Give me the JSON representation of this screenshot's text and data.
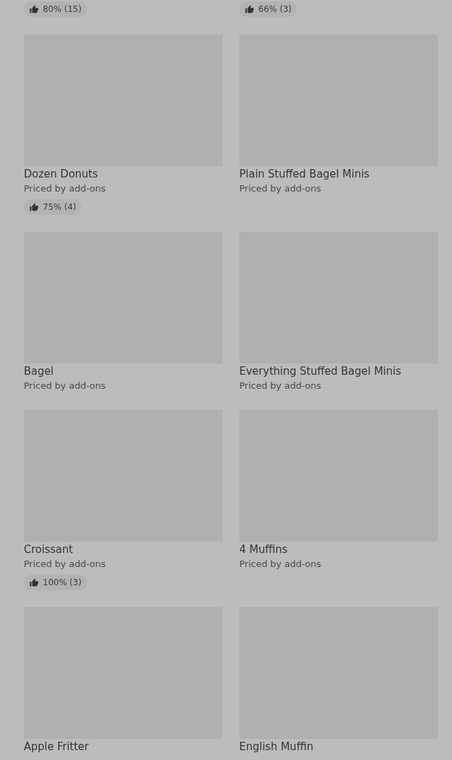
{
  "top_ratings": [
    {
      "rating": "80% (15)"
    },
    {
      "rating": "66% (3)"
    }
  ],
  "items": [
    {
      "name": "Dozen Donuts",
      "price": "Priced by add-ons",
      "rating": "75% (4)"
    },
    {
      "name": "Plain Stuffed Bagel Minis",
      "price": "Priced by add-ons"
    },
    {
      "name": "Bagel",
      "price": "Priced by add-ons"
    },
    {
      "name": "Everything Stuffed Bagel Minis",
      "price": "Priced by add-ons"
    },
    {
      "name": "Croissant",
      "price": "Priced by add-ons",
      "rating": "100% (3)"
    },
    {
      "name": "4 Muffins",
      "price": "Priced by add-ons"
    },
    {
      "name": "Apple Fritter"
    },
    {
      "name": "English Muffin"
    }
  ]
}
